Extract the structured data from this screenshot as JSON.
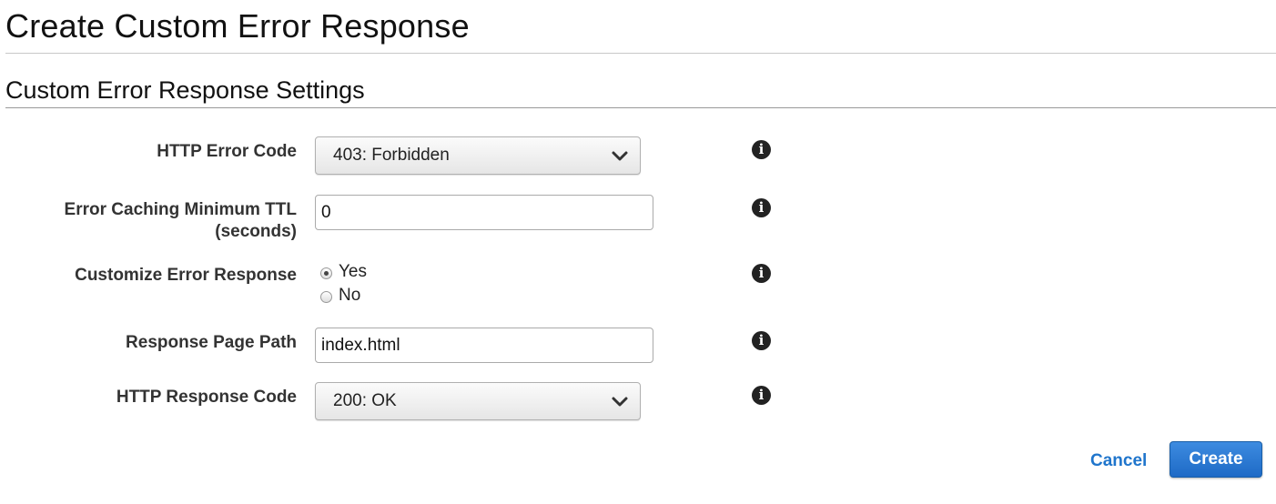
{
  "page": {
    "title": "Create Custom Error Response",
    "section_title": "Custom Error Response Settings"
  },
  "form": {
    "http_error_code": {
      "label": "HTTP Error Code",
      "value": "403: Forbidden",
      "info_icon": "info-icon"
    },
    "error_caching_ttl": {
      "label_line1": "Error Caching Minimum TTL",
      "label_line2": "(seconds)",
      "value": "0",
      "info_icon": "info-icon"
    },
    "customize_error_response": {
      "label": "Customize Error Response",
      "options": [
        {
          "label": "Yes",
          "checked": true
        },
        {
          "label": "No",
          "checked": false
        }
      ],
      "info_icon": "info-icon"
    },
    "response_page_path": {
      "label": "Response Page Path",
      "value": "index.html",
      "info_icon": "info-icon"
    },
    "http_response_code": {
      "label": "HTTP Response Code",
      "value": "200: OK",
      "info_icon": "info-icon"
    }
  },
  "actions": {
    "cancel_label": "Cancel",
    "create_label": "Create"
  },
  "colors": {
    "link": "#1f75cc",
    "primary_button": "#2a7bd6"
  }
}
